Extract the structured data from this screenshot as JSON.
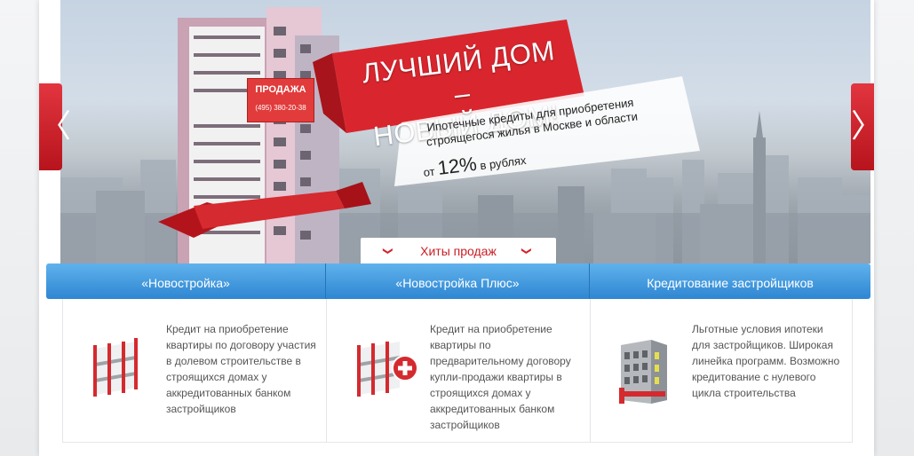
{
  "hero": {
    "sign_title": "ПРОДАЖА",
    "sign_phone": "(495) 380-20-38",
    "promo_title_line1": "ЛУЧШИЙ ДОМ –",
    "promo_title_line2": "НОВЫЙ ДОМ!",
    "promo_desc_line1": "Ипотечные кредиты для приобретения",
    "promo_desc_line2": "строящегося жилья в Москве и области",
    "promo_prefix": "от",
    "promo_rate": "12%",
    "promo_suffix": "в рублях",
    "hits_label": "Хиты продаж"
  },
  "nav": {
    "prev_glyph": "〈",
    "next_glyph": "〉",
    "chevron_glyph": "❯"
  },
  "tabs": [
    {
      "label": "«Новостройка»"
    },
    {
      "label": "«Новостройка Плюс»"
    },
    {
      "label": "Кредитование застройщиков"
    }
  ],
  "cards": [
    {
      "text": "Кредит на приобретение квартиры по договору участия в долевом строительстве в строящихся домах у аккредитованных банком застройщиков",
      "icon": "building-frame-icon"
    },
    {
      "text": "Кредит на приобретение квартиры по предварительному договору купли-продажи квартиры в строящихся домах у аккредитованных банком застройщиков",
      "icon": "building-frame-plus-icon"
    },
    {
      "text": "Льготные условия ипотеки для застройщиков. Широкая линейка программ. Возможно кредитование с нулевого цикла строительства",
      "icon": "building-icon"
    }
  ],
  "colors": {
    "accent": "#d52028",
    "tab_blue": "#2f86d2"
  }
}
